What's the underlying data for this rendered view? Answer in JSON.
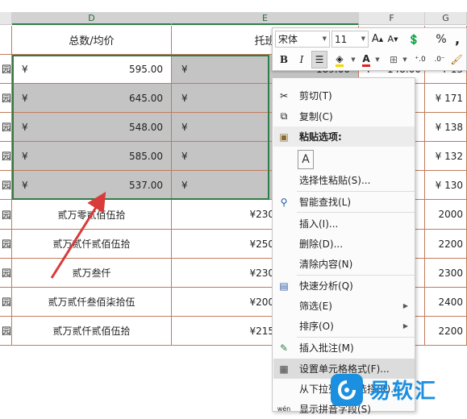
{
  "columns": [
    {
      "label": "",
      "selected": false
    },
    {
      "label": "D",
      "selected": true
    },
    {
      "label": "E",
      "selected": true
    },
    {
      "label": "F",
      "selected": false
    },
    {
      "label": "G",
      "selected": false
    }
  ],
  "header_row": {
    "a": "园",
    "d": "总数/均价",
    "e": "托班"
  },
  "selected_rows": [
    {
      "a": "园",
      "currency": "¥",
      "d_amount": "595.00",
      "e_currency": "¥",
      "e_amount": "189.00",
      "f": "¥",
      "f_value": "148.00",
      "g": "¥ 13"
    },
    {
      "a": "园",
      "currency": "¥",
      "d_amount": "645.00",
      "e_currency": "¥",
      "e_amount": "",
      "f": "",
      "f_value": "",
      "g": "¥ 171"
    },
    {
      "a": "园",
      "currency": "¥",
      "d_amount": "548.00",
      "e_currency": "¥",
      "e_amount": "",
      "f": "",
      "f_value": "",
      "g": "¥ 138"
    },
    {
      "a": "园",
      "currency": "¥",
      "d_amount": "585.00",
      "e_currency": "¥",
      "e_amount": "",
      "f": "",
      "f_value": "",
      "g": "¥ 132"
    },
    {
      "a": "园",
      "currency": "¥",
      "d_amount": "537.00",
      "e_currency": "¥",
      "e_amount": "",
      "f": "",
      "f_value": "",
      "g": "¥ 130"
    }
  ],
  "lower_rows": [
    {
      "a": "园",
      "d": "贰万零贰佰伍拾",
      "e": "¥230",
      "g": "2000"
    },
    {
      "a": "园",
      "d": "贰万贰仟贰佰伍拾",
      "e": "¥250",
      "g": "2200"
    },
    {
      "a": "园",
      "d": "贰万叁仟",
      "e": "¥230",
      "g": "2300"
    },
    {
      "a": "园",
      "d": "贰万贰仟叁佰柒拾伍",
      "e": "¥200",
      "g": "2400"
    },
    {
      "a": "园",
      "d": "贰万贰仟贰佰伍拾",
      "e": "¥215",
      "g": "2200"
    }
  ],
  "mini_toolbar": {
    "font_name": "宋体",
    "font_size": "11",
    "bold": "B",
    "italic": "I",
    "percent": "%",
    "comma": ",",
    "font_color_letter": "A"
  },
  "context_menu": {
    "items": [
      {
        "label": "剪切(T)",
        "icon": "scissors-icon",
        "glyph": "✂",
        "kind": "item"
      },
      {
        "label": "复制(C)",
        "icon": "copy-icon",
        "glyph": "⧉",
        "kind": "item"
      },
      {
        "label": "粘贴选项:",
        "icon": "paste-icon",
        "glyph": "📋",
        "kind": "section"
      },
      {
        "label": "",
        "icon": "paste-keep-text-icon",
        "glyph": "A",
        "kind": "paste-option"
      },
      {
        "label": "选择性粘贴(S)...",
        "icon": "",
        "glyph": "",
        "kind": "item"
      },
      {
        "label": "智能查找(L)",
        "icon": "smart-lookup-icon",
        "glyph": "⚲",
        "kind": "item"
      },
      {
        "label": "插入(I)...",
        "icon": "",
        "glyph": "",
        "kind": "item"
      },
      {
        "label": "删除(D)...",
        "icon": "",
        "glyph": "",
        "kind": "item"
      },
      {
        "label": "清除内容(N)",
        "icon": "",
        "glyph": "",
        "kind": "item"
      },
      {
        "label": "快速分析(Q)",
        "icon": "quick-analysis-icon",
        "glyph": "▤",
        "kind": "item"
      },
      {
        "label": "筛选(E)",
        "icon": "",
        "glyph": "",
        "kind": "submenu"
      },
      {
        "label": "排序(O)",
        "icon": "",
        "glyph": "",
        "kind": "submenu"
      },
      {
        "label": "插入批注(M)",
        "icon": "insert-comment-icon",
        "glyph": "✎",
        "kind": "item"
      },
      {
        "label": "设置单元格格式(F)...",
        "icon": "format-cells-icon",
        "glyph": "▦",
        "kind": "highlight"
      },
      {
        "label": "从下拉列表中选择(K)...",
        "icon": "",
        "glyph": "",
        "kind": "item"
      },
      {
        "label": "显示拼音字段(S)",
        "icon": "phonetic-icon",
        "glyph": "wén",
        "kind": "item"
      }
    ]
  },
  "watermark": {
    "text": "易软汇",
    "accent": "#1b8fe0"
  },
  "colors": {
    "selection_border": "#2f7d46",
    "selected_fill": "#c4c4c4",
    "cell_border": "#c27b5b",
    "arrow": "#d93a3a"
  }
}
